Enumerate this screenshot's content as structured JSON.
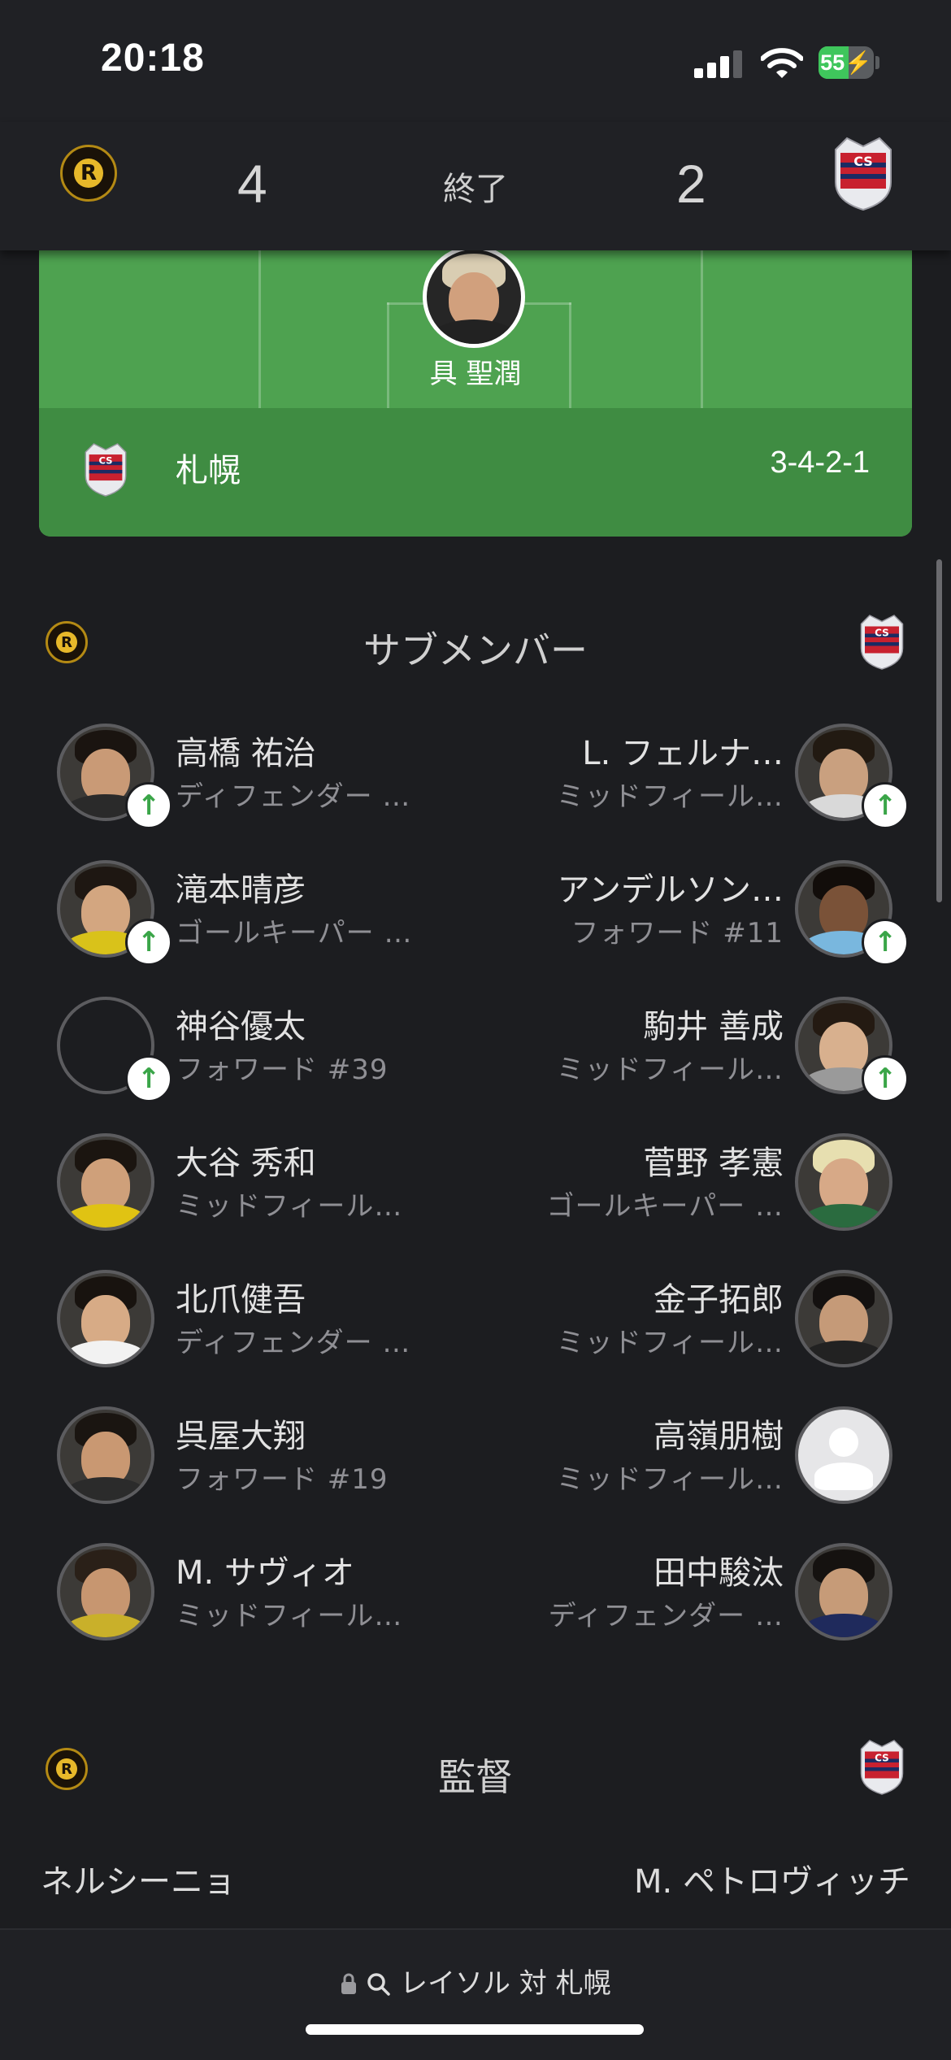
{
  "status_bar": {
    "time": "20:18",
    "battery_percent": "55",
    "battery_level": 0.55,
    "icons": [
      "signal-icon",
      "wifi-icon",
      "battery-charging-icon"
    ]
  },
  "match": {
    "home_score": "4",
    "away_score": "2",
    "status": "終了",
    "home_crest": "kashiwa-reysol-crest",
    "away_crest": "consadole-sapporo-crest"
  },
  "pitch": {
    "goalkeeper_name": "具 聖潤",
    "team_name": "札幌",
    "formation": "3-4-2-1"
  },
  "subs": {
    "title": "サブメンバー",
    "home": [
      {
        "name": "高橋 祐治",
        "position": "ディフェンダー …",
        "subbed_in": true,
        "avatar": "photo"
      },
      {
        "name": "滝本晴彦",
        "position": "ゴールキーパー …",
        "subbed_in": true,
        "avatar": "photo"
      },
      {
        "name": "神谷優太",
        "position": "フォワード #39",
        "subbed_in": true,
        "avatar": "empty"
      },
      {
        "name": "大谷 秀和",
        "position": "ミッドフィール…",
        "subbed_in": false,
        "avatar": "photo"
      },
      {
        "name": "北爪健吾",
        "position": "ディフェンダー …",
        "subbed_in": false,
        "avatar": "photo"
      },
      {
        "name": "呉屋大翔",
        "position": "フォワード #19",
        "subbed_in": false,
        "avatar": "photo"
      },
      {
        "name": "M. サヴィオ",
        "position": "ミッドフィール…",
        "subbed_in": false,
        "avatar": "photo"
      }
    ],
    "away": [
      {
        "name": "L. フェルナ…",
        "position": "ミッドフィール…",
        "subbed_in": true,
        "avatar": "photo"
      },
      {
        "name": "アンデルソン…",
        "position": "フォワード #11",
        "subbed_in": true,
        "avatar": "photo"
      },
      {
        "name": "駒井 善成",
        "position": "ミッドフィール…",
        "subbed_in": true,
        "avatar": "photo"
      },
      {
        "name": "菅野 孝憲",
        "position": "ゴールキーパー …",
        "subbed_in": false,
        "avatar": "photo"
      },
      {
        "name": "金子拓郎",
        "position": "ミッドフィール…",
        "subbed_in": false,
        "avatar": "photo"
      },
      {
        "name": "高嶺朋樹",
        "position": "ミッドフィール…",
        "subbed_in": false,
        "avatar": "placeholder"
      },
      {
        "name": "田中駿汰",
        "position": "ディフェンダー …",
        "subbed_in": false,
        "avatar": "photo"
      }
    ]
  },
  "managers": {
    "title": "監督",
    "home": "ネルシーニョ",
    "away": "M. ペトロヴィッチ"
  },
  "bottom_bar": {
    "search_text": "レイソル 対 札幌",
    "icons": [
      "lock-icon",
      "search-icon"
    ]
  },
  "colors": {
    "background": "#1c1d20",
    "pitch_green": "#4ea250",
    "pitch_footer": "#3f8c42",
    "sub_arrow": "#3aa548",
    "battery_green": "#3fc65c"
  }
}
